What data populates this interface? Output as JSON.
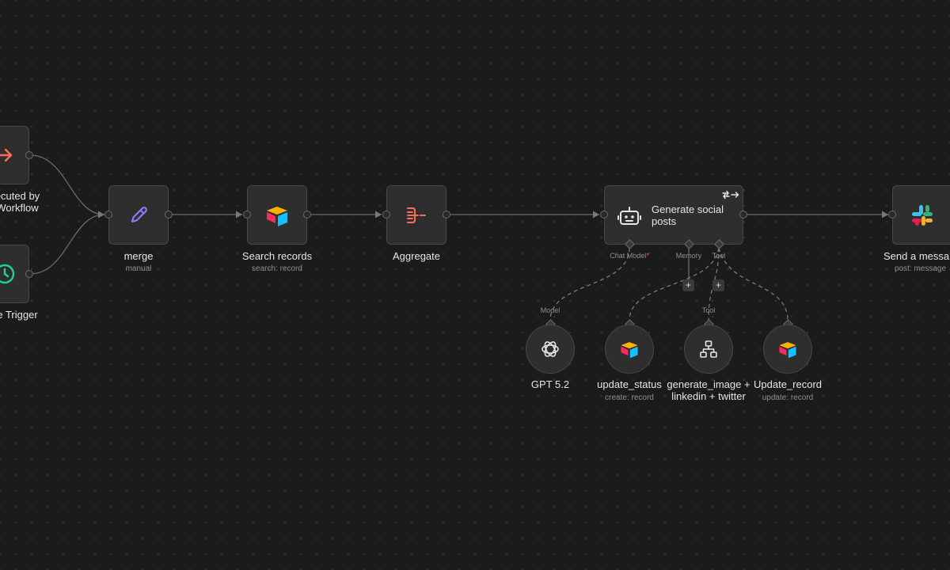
{
  "nodes": {
    "execute_workflow": {
      "label_line1": "ecuted by",
      "label_line2": "Workflow",
      "icon": "arrow-right-icon"
    },
    "schedule_trigger": {
      "label": "e Trigger",
      "icon": "clock-icon"
    },
    "merge": {
      "label": "merge",
      "sublabel": "manual",
      "icon": "pencil-icon"
    },
    "search_records": {
      "label": "Search records",
      "sublabel": "search: record",
      "icon": "airtable-icon"
    },
    "aggregate": {
      "label": "Aggregate",
      "icon": "aggregate-icon"
    },
    "generate_social": {
      "label": "Generate social posts",
      "icon": "robot-icon",
      "badge_icon": "repeat-arrow-icon"
    },
    "send_message": {
      "label": "Send a messa",
      "sublabel": "post: message",
      "icon": "slack-icon"
    },
    "gpt": {
      "label": "GPT 5.2",
      "icon": "openai-icon"
    },
    "update_status": {
      "label": "update_status",
      "sublabel": "create: record",
      "icon": "airtable-icon"
    },
    "generate_image": {
      "label_line1": "generate_image +",
      "label_line2": "linkedin + twitter",
      "icon": "workflow-icon"
    },
    "update_record": {
      "label": "Update_record",
      "sublabel": "update: record",
      "icon": "airtable-icon"
    }
  },
  "ports": {
    "chat_model": "Chat Model",
    "chat_model_required": "*",
    "memory": "Memory",
    "tool": "Tool",
    "model": "Model",
    "tool_sub": "Tool"
  },
  "buttons": {
    "add_memory": "+",
    "add_tool": "+"
  },
  "colors": {
    "background": "#1b1b1b",
    "node": "#2e2e2e",
    "wire": "#6b6b6b",
    "merge_icon": "#8b7cf6",
    "trigger_arrow": "#ff6d5a",
    "schedule_clock": "#1dd1a1",
    "aggregate_icon": "#ff6d5a"
  }
}
